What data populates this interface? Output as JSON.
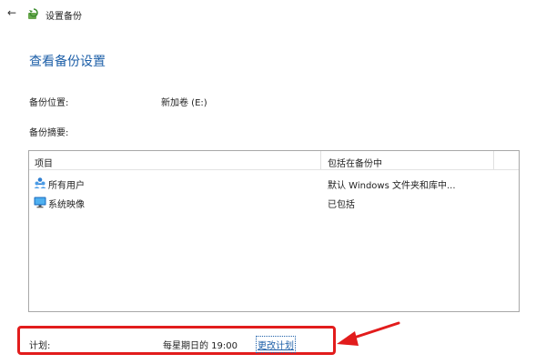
{
  "window": {
    "back_glyph": "←",
    "title": "设置备份"
  },
  "page": {
    "title": "查看备份设置"
  },
  "backup_location": {
    "label": "备份位置:",
    "value": "新加卷 (E:)"
  },
  "backup_summary": {
    "label": "备份摘要:",
    "columns": [
      "项目",
      "包括在备份中"
    ],
    "rows": [
      {
        "icon": "users-icon",
        "name": "所有用户",
        "status": "默认 Windows 文件夹和库中..."
      },
      {
        "icon": "monitor-icon",
        "name": "系统映像",
        "status": "已包括"
      }
    ]
  },
  "schedule": {
    "label": "计划:",
    "value": "每星期日的 19:00",
    "change_link": "更改计划"
  },
  "annotation": {
    "color": "#e21c1c"
  },
  "colors": {
    "accent": "#1d5fa8"
  }
}
